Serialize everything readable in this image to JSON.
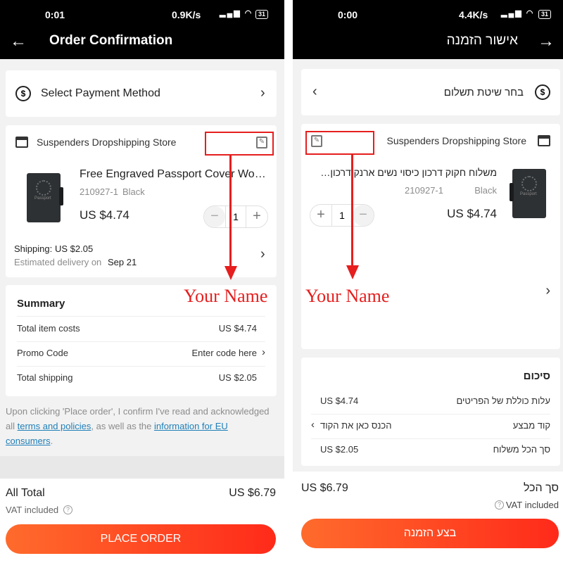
{
  "left": {
    "status": {
      "time": "0:01",
      "speed": "0.9K/s",
      "battery": "31"
    },
    "title": "Order Confirmation",
    "payment_label": "Select Payment Method",
    "store_name": "Suspenders Dropshipping Store",
    "product": {
      "name": "Free Engraved Passport Cover Wo…",
      "sku": "210927-1",
      "variant": "Black",
      "price": "US $4.74",
      "quantity": "1"
    },
    "shipping_label": "Shipping:",
    "shipping_cost": "US $2.05",
    "delivery_prefix": "Estimated delivery on",
    "delivery_date": "Sep 21",
    "annotation": "Your Name",
    "summary": {
      "title": "Summary",
      "rows": [
        {
          "label": "Total item costs",
          "value": "US $4.74"
        },
        {
          "label": "Promo Code",
          "value": "Enter code here"
        },
        {
          "label": "Total shipping",
          "value": "US $2.05"
        }
      ]
    },
    "disclaimer": {
      "part1": "Upon clicking 'Place order', I confirm I've read and acknowledged all ",
      "link1": "terms and policies",
      "part2": ", as well as the ",
      "link2": "information for EU consumers",
      "part3": "."
    },
    "total_label": "All Total",
    "total_value": "US $6.79",
    "vat": "VAT included",
    "button": "PLACE ORDER"
  },
  "right": {
    "status": {
      "time": "0:00",
      "speed": "4.4K/s",
      "battery": "31"
    },
    "title": "אישור הזמנה",
    "payment_label": "בחר שיטת תשלום",
    "store_name": "Suspenders Dropshipping Store",
    "product": {
      "name": "משלוח חקוק דרכון כיסוי נשים ארנק דרכון…",
      "sku": "210927-1",
      "variant": "Black",
      "price": "US $4.74",
      "quantity": "1"
    },
    "annotation": "Your Name",
    "summary": {
      "title": "סיכום",
      "rows": [
        {
          "label": "עלות כוללת של הפריטים",
          "value": "US $4.74"
        },
        {
          "label": "קוד מבצע",
          "value": "הכנס כאן את הקוד"
        },
        {
          "label": "סך הכל משלוח",
          "value": "US $2.05"
        }
      ]
    },
    "total_label": "סך הכל",
    "total_value": "US $6.79",
    "vat": "VAT included",
    "button": "בצע הזמנה"
  },
  "colors": {
    "accent": "#ff3d1f",
    "annotation": "#e61e1e",
    "link": "#1f7fb8"
  }
}
